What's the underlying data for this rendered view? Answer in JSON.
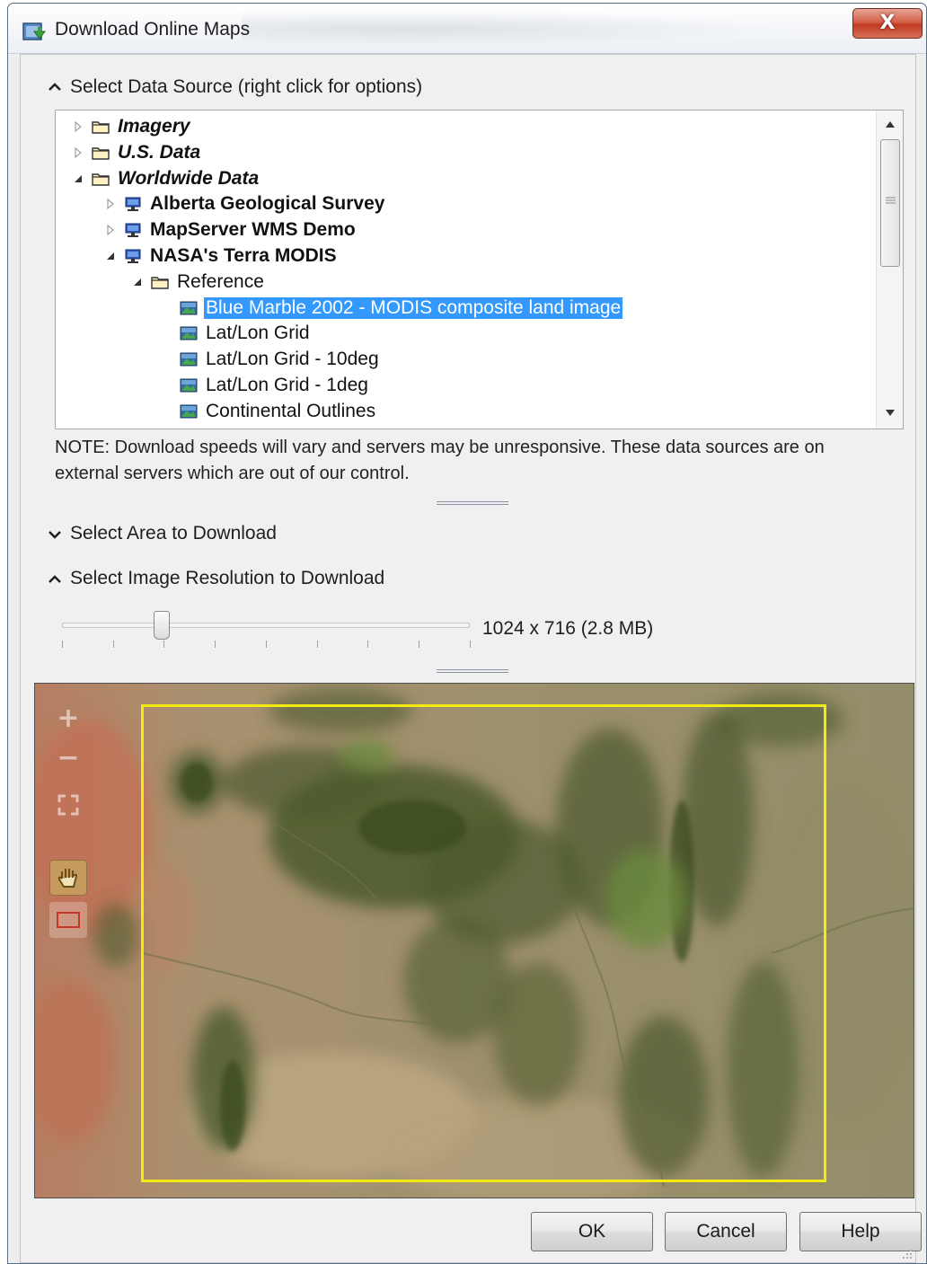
{
  "window": {
    "title": "Download Online Maps",
    "close_label": "X"
  },
  "data_source": {
    "header": "Select Data Source (right click for options)",
    "tree": [
      {
        "label": "Imagery",
        "level": 0,
        "expanded": false,
        "kind": "folder",
        "style": "bold-italic"
      },
      {
        "label": "U.S. Data",
        "level": 0,
        "expanded": false,
        "kind": "folder",
        "style": "bold-italic"
      },
      {
        "label": "Worldwide Data",
        "level": 0,
        "expanded": true,
        "kind": "folder",
        "style": "bold-italic"
      },
      {
        "label": "Alberta Geological Survey",
        "level": 1,
        "expanded": false,
        "kind": "server",
        "style": "bold"
      },
      {
        "label": "MapServer WMS Demo",
        "level": 1,
        "expanded": false,
        "kind": "server",
        "style": "bold"
      },
      {
        "label": "NASA's Terra MODIS",
        "level": 1,
        "expanded": true,
        "kind": "server",
        "style": "bold"
      },
      {
        "label": "Reference",
        "level": 2,
        "expanded": true,
        "kind": "folder",
        "style": "normal"
      },
      {
        "label": "Blue Marble 2002 - MODIS composite land image",
        "level": 3,
        "kind": "layer",
        "style": "normal",
        "selected": true
      },
      {
        "label": "Lat/Lon Grid",
        "level": 3,
        "kind": "layer",
        "style": "normal"
      },
      {
        "label": "Lat/Lon Grid - 10deg",
        "level": 3,
        "kind": "layer",
        "style": "normal"
      },
      {
        "label": "Lat/Lon Grid - 1deg",
        "level": 3,
        "kind": "layer",
        "style": "normal"
      },
      {
        "label": "Continental Outlines",
        "level": 3,
        "kind": "layer",
        "style": "normal"
      }
    ],
    "note": "NOTE: Download speeds will vary and servers may be unresponsive.  These data sources are on external servers which are out of our control."
  },
  "area": {
    "header": "Select Area to Download",
    "collapsed": true
  },
  "resolution": {
    "header": "Select Image Resolution to Download",
    "value_text": "1024 x 716  (2.8 MB)",
    "slider_position_fraction": 0.25
  },
  "map_tools": [
    "zoom-in-icon",
    "zoom-out-icon",
    "zoom-extent-icon",
    "pan-hand-icon",
    "draw-rectangle-icon"
  ],
  "buttons": {
    "ok": "OK",
    "cancel": "Cancel",
    "help": "Help"
  },
  "colors": {
    "selection": "#3399ff",
    "area_box": "#f2ea10"
  }
}
